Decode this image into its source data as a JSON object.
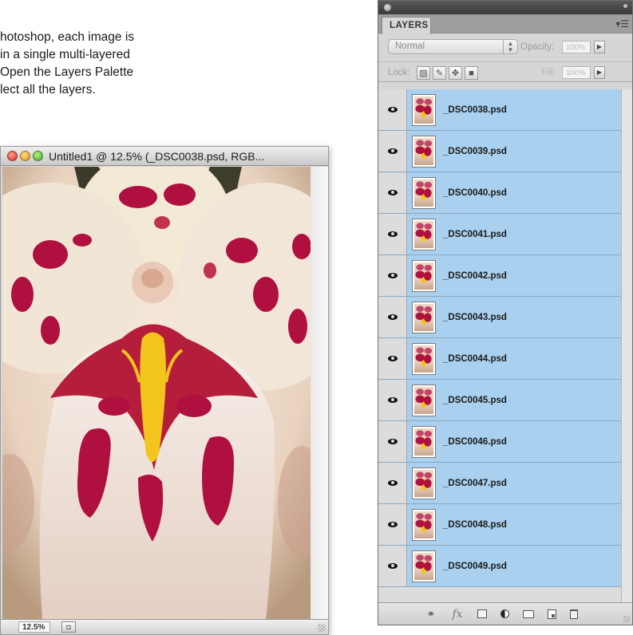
{
  "book_text": {
    "lines": [
      "hotoshop, each image is",
      "in a single multi-layered",
      "Open the Layers Palette",
      "lect all the layers."
    ]
  },
  "document_window": {
    "title": "Untitled1 @ 12.5% (_DSC0038.psd, RGB...",
    "zoom": "12.5%"
  },
  "layers_panel": {
    "tab_label": "LAYERS",
    "blend_mode": "Normal",
    "opacity_label": "Opacity:",
    "opacity_value": "100%",
    "lock_label": "Lock:",
    "fill_label": "Fill:",
    "fill_value": "100%",
    "layers": [
      "_DSC0038.psd",
      "_DSC0039.psd",
      "_DSC0040.psd",
      "_DSC0041.psd",
      "_DSC0042.psd",
      "_DSC0043.psd",
      "_DSC0044.psd",
      "_DSC0045.psd",
      "_DSC0046.psd",
      "_DSC0047.psd",
      "_DSC0048.psd",
      "_DSC0049.psd"
    ],
    "bottom_icons": [
      "link-icon",
      "fx-icon",
      "mask-icon",
      "adjustment-icon",
      "folder-icon",
      "new-layer-icon",
      "trash-icon"
    ]
  },
  "colors": {
    "selected_layer": "#a9d0ee",
    "petal_spot": "#b0103f",
    "lip_yellow": "#f3c51c"
  }
}
